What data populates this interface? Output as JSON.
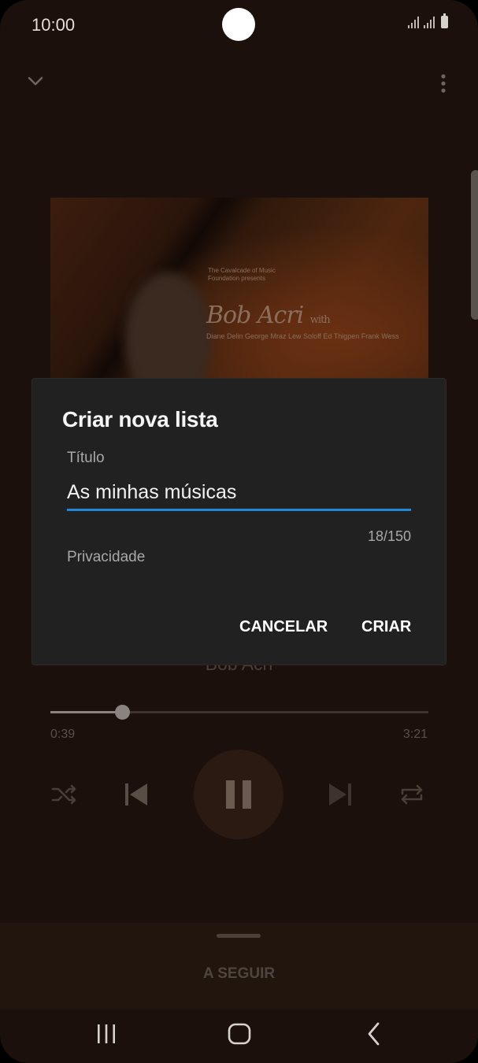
{
  "status_bar": {
    "time": "10:00"
  },
  "album_art": {
    "presenter": "The Cavalcade of Music Foundation presents",
    "artist_name": "Bob Acri",
    "with_word": "with",
    "performers": "Diane Delin George Mraz Lew Soloff Ed Thigpen Frank Wess"
  },
  "player": {
    "artist": "Bob Acri",
    "elapsed": "0:39",
    "total": "3:21",
    "progress_fraction": 0.19
  },
  "up_next": {
    "label": "A SEGUIR"
  },
  "dialog": {
    "title": "Criar nova lista",
    "field_label": "Título",
    "field_value": "As minhas músicas",
    "char_counter": "18/150",
    "privacy_label": "Privacidade",
    "cancel_label": "CANCELAR",
    "create_label": "CRIAR"
  },
  "colors": {
    "accent": "#1f86d8",
    "dialog_bg": "#212121",
    "screen_bg": "#1b100b"
  },
  "icons": {
    "collapse": "chevron-down-icon",
    "more": "more-vertical-icon",
    "shuffle": "shuffle-icon",
    "previous": "skip-previous-icon",
    "pause": "pause-icon",
    "next": "skip-next-icon",
    "repeat": "repeat-icon",
    "recents": "recents-icon",
    "home": "home-icon",
    "back": "back-icon"
  }
}
